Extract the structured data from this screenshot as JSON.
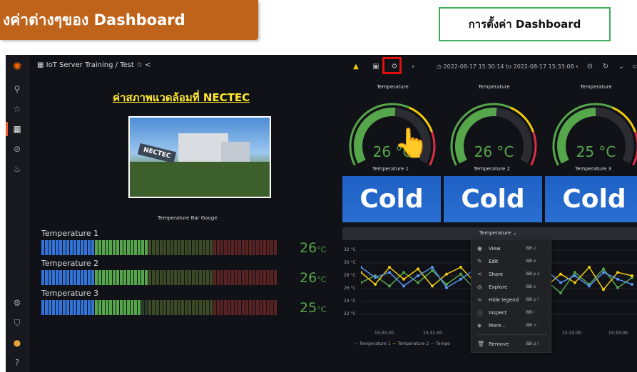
{
  "banner": {
    "text": "งค่าต่างๆของ Dashboard"
  },
  "settings_box": {
    "text": "การตั้งค่า Dashboard"
  },
  "topbar": {
    "breadcrumb": "IoT Server Training / Test",
    "time_range": "2022-08-17 15:30:14 to 2022-08-17 15:33:08"
  },
  "page_title": "ค่าสภาพแวดล้อมที่ NECTEC",
  "photo_sign": "NECTEC",
  "bar_gauge": {
    "title": "Temperature Bar Gauge",
    "rows": [
      {
        "label": "Temperature 1",
        "value": "26",
        "unit": "°C",
        "fraction": 0.45
      },
      {
        "label": "Temperature 2",
        "value": "26",
        "unit": "°C",
        "fraction": 0.45
      },
      {
        "label": "Temperature 3",
        "value": "25",
        "unit": "°C",
        "fraction": 0.43
      }
    ]
  },
  "gauges": [
    {
      "title": "Temperature",
      "value": "26 °C",
      "fraction": 0.52
    },
    {
      "title": "Temperature",
      "value": "26 °C",
      "fraction": 0.52
    },
    {
      "title": "Temperature",
      "value": "25 °C",
      "fraction": 0.5
    }
  ],
  "stats": [
    {
      "title": "Temperature 1",
      "value": "Cold"
    },
    {
      "title": "Temperature 2",
      "value": "Cold"
    },
    {
      "title": "Temperature 3",
      "value": "Cold"
    }
  ],
  "timeseries": {
    "title": "Temperature",
    "y_ticks": [
      "32 °C",
      "30 °C",
      "28 °C",
      "26 °C",
      "24 °C",
      "22 °C"
    ],
    "x_ticks": [
      "15:30:30",
      "15:31:00",
      "15:32:30",
      "15:33:00"
    ],
    "legend": [
      "Temperature 1",
      "Temperature 2",
      "Tempe"
    ]
  },
  "context_menu": {
    "items": [
      {
        "icon": "eye-icon",
        "glyph": "◉",
        "label": "View",
        "key": "v"
      },
      {
        "icon": "edit-icon",
        "glyph": "✎",
        "label": "Edit",
        "key": "e"
      },
      {
        "icon": "share-icon",
        "glyph": "<",
        "label": "Share",
        "key": "p s"
      },
      {
        "icon": "explore-icon",
        "glyph": "◎",
        "label": "Explore",
        "key": "x"
      },
      {
        "icon": "legend-icon",
        "glyph": "≈",
        "label": "Hide legend",
        "key": "p l"
      },
      {
        "icon": "inspect-icon",
        "glyph": "ⓘ",
        "label": "Inspect",
        "key": "i"
      },
      {
        "icon": "cube-icon",
        "glyph": "◈",
        "label": "More...",
        "key": ">"
      },
      {
        "icon": "trash-icon",
        "glyph": "🗑",
        "label": "Remove",
        "key": "p r"
      }
    ]
  },
  "colors": {
    "banner": "#c0631a",
    "settings_border": "#3cae5a",
    "stat_bg": "#1f60c4",
    "value_green": "#56a64b",
    "title_yellow": "#ffe82e",
    "highlight_red": "#e01010",
    "series": [
      "#56a64b",
      "#f2cc0c",
      "#5794f2"
    ]
  }
}
